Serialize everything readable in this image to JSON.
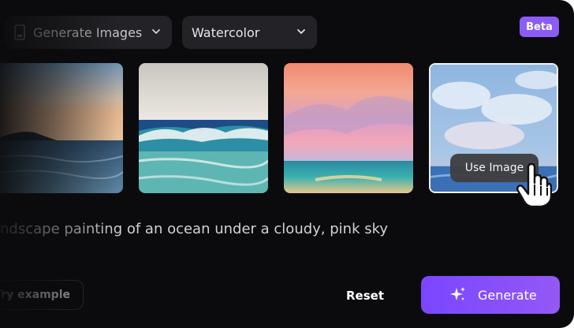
{
  "toolbar": {
    "mode_dropdown": {
      "value": "Generate Images",
      "icon": "image-mode-icon"
    },
    "style_dropdown": {
      "value": "Watercolor",
      "icon": "chevron-down-icon"
    },
    "badge": "Beta",
    "colors": {
      "accent": "#8b5cf6",
      "panel": "#0b0b0d",
      "control": "#232327"
    }
  },
  "gallery": {
    "images": [
      {
        "name": "watercolor-sunset-coast"
      },
      {
        "name": "watercolor-ocean-waves"
      },
      {
        "name": "watercolor-pink-sky-sea"
      },
      {
        "name": "watercolor-cloudy-blue-sky"
      }
    ],
    "hover_action": "Use Image",
    "cursor": "hand-pointer"
  },
  "prompt": {
    "text": "ndscape painting of an ocean under a cloudy, pink sky"
  },
  "actions": {
    "try_example": "Try example",
    "reset": "Reset",
    "generate": "Generate",
    "generate_icon": "sparkle-icon"
  }
}
